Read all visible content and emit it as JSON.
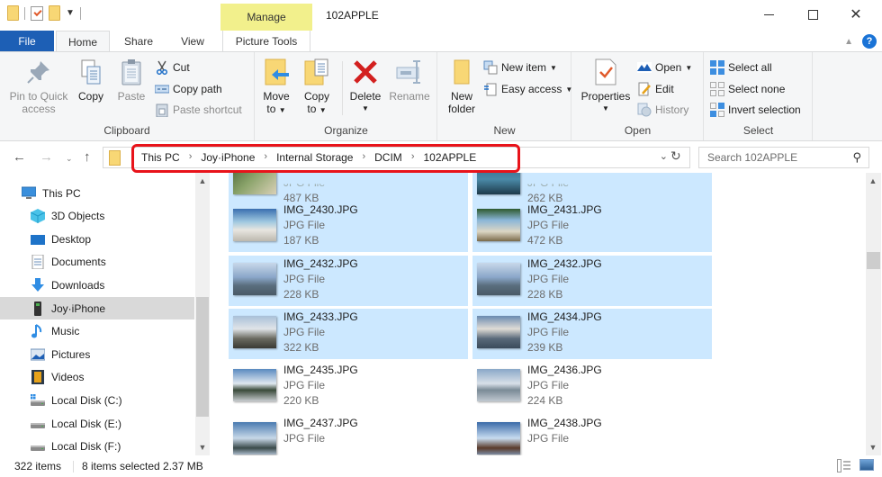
{
  "window": {
    "title": "102APPLE",
    "context_tab": "Manage",
    "controls": {
      "minimize": "minimize-icon",
      "maximize": "maximize-icon",
      "close": "close-icon"
    }
  },
  "ribbon_tabs": [
    {
      "label": "File"
    },
    {
      "label": "Home"
    },
    {
      "label": "Share"
    },
    {
      "label": "View"
    },
    {
      "label": "Picture Tools"
    }
  ],
  "ribbon": {
    "clipboard": {
      "label": "Clipboard",
      "pin": "Pin to Quick access",
      "pin_line1": "Pin to Quick",
      "pin_line2": "access",
      "copy": "Copy",
      "paste": "Paste",
      "cut": "Cut",
      "copy_path": "Copy path",
      "paste_shortcut": "Paste shortcut"
    },
    "organize": {
      "label": "Organize",
      "move_to_line1": "Move",
      "move_to_line2": "to",
      "copy_to_line1": "Copy",
      "copy_to_line2": "to",
      "delete": "Delete",
      "rename": "Rename"
    },
    "new": {
      "label": "New",
      "new_folder_line1": "New",
      "new_folder_line2": "folder",
      "new_item": "New item",
      "easy_access": "Easy access"
    },
    "open": {
      "label": "Open",
      "properties": "Properties",
      "open": "Open",
      "edit": "Edit",
      "history": "History"
    },
    "select": {
      "label": "Select",
      "select_all": "Select all",
      "select_none": "Select none",
      "invert_selection": "Invert selection"
    }
  },
  "address": {
    "breadcrumbs": [
      "This PC",
      "Joy·iPhone",
      "Internal Storage",
      "DCIM",
      "102APPLE"
    ],
    "search_placeholder": "Search 102APPLE"
  },
  "sidebar": {
    "items": [
      {
        "label": "This PC",
        "icon": "computer-icon"
      },
      {
        "label": "3D Objects",
        "icon": "3d-objects-icon"
      },
      {
        "label": "Desktop",
        "icon": "desktop-icon"
      },
      {
        "label": "Documents",
        "icon": "documents-icon"
      },
      {
        "label": "Downloads",
        "icon": "downloads-icon"
      },
      {
        "label": "Joy·iPhone",
        "icon": "phone-icon",
        "selected": true
      },
      {
        "label": "Music",
        "icon": "music-icon"
      },
      {
        "label": "Pictures",
        "icon": "pictures-icon"
      },
      {
        "label": "Videos",
        "icon": "videos-icon"
      },
      {
        "label": "Local Disk (C:)",
        "icon": "drive-icon"
      },
      {
        "label": "Local Disk (E:)",
        "icon": "drive-icon"
      },
      {
        "label": "Local Disk (F:)",
        "icon": "drive-icon"
      }
    ]
  },
  "files": [
    {
      "name": "",
      "type": "JPG File",
      "size": "487 KB",
      "selected": true
    },
    {
      "name": "",
      "type": "JPG File",
      "size": "262 KB",
      "selected": true
    },
    {
      "name": "IMG_2430.JPG",
      "type": "JPG File",
      "size": "187 KB",
      "selected": true
    },
    {
      "name": "IMG_2431.JPG",
      "type": "JPG File",
      "size": "472 KB",
      "selected": true
    },
    {
      "name": "IMG_2432.JPG",
      "type": "JPG File",
      "size": "228 KB",
      "selected": true
    },
    {
      "name": "IMG_2432.JPG",
      "type": "JPG File",
      "size": "228 KB",
      "selected": true
    },
    {
      "name": "IMG_2433.JPG",
      "type": "JPG File",
      "size": "322 KB",
      "selected": true
    },
    {
      "name": "IMG_2434.JPG",
      "type": "JPG File",
      "size": "239 KB",
      "selected": true
    },
    {
      "name": "IMG_2435.JPG",
      "type": "JPG File",
      "size": "220 KB",
      "selected": false
    },
    {
      "name": "IMG_2436.JPG",
      "type": "JPG File",
      "size": "224 KB",
      "selected": false
    },
    {
      "name": "IMG_2437.JPG",
      "type": "JPG File",
      "size": "",
      "selected": false
    },
    {
      "name": "IMG_2438.JPG",
      "type": "JPG File",
      "size": "",
      "selected": false
    }
  ],
  "status": {
    "item_count": "322 items",
    "selection": "8 items selected  2.37 MB"
  },
  "colors": {
    "file_tab": "#1d5fb5",
    "manage_tab": "#f2f08c",
    "selection": "#cce8ff",
    "highlight_box": "#e8131a"
  }
}
